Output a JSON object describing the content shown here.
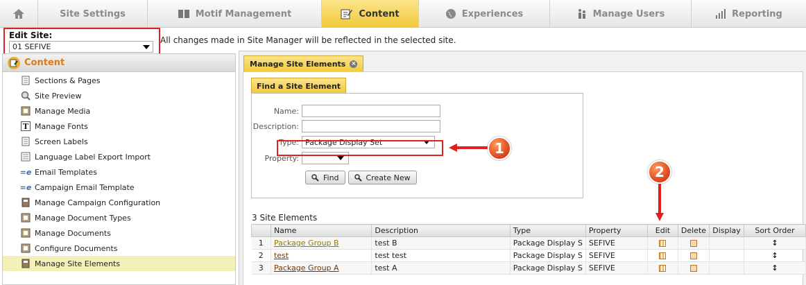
{
  "topnav": {
    "tabs": [
      {
        "label": "Site Settings",
        "icon": "settings-icon"
      },
      {
        "label": "Motif Management",
        "icon": "book-icon"
      },
      {
        "label": "Content",
        "icon": "edit-icon",
        "active": true
      },
      {
        "label": "Experiences",
        "icon": "globe-icon"
      },
      {
        "label": "Manage Users",
        "icon": "users-icon"
      },
      {
        "label": "Reporting",
        "icon": "bar-chart-icon"
      }
    ]
  },
  "edit_site": {
    "label": "Edit Site:",
    "value": "01 SEFIVE"
  },
  "notice": "All changes made in Site Manager will be reflected in the selected site.",
  "left_panel": {
    "title": "Content",
    "items": [
      {
        "label": "Sections & Pages",
        "icon": "document-icon"
      },
      {
        "label": "Site Preview",
        "icon": "magnifier-icon"
      },
      {
        "label": "Manage Media",
        "icon": "media-icon"
      },
      {
        "label": "Manage Fonts",
        "icon": "font-icon"
      },
      {
        "label": "Screen Labels",
        "icon": "document-icon"
      },
      {
        "label": "Language Label Export Import",
        "icon": "export-icon"
      },
      {
        "label": "Email Templates",
        "icon": "email-icon"
      },
      {
        "label": "Campaign Email Template",
        "icon": "email-icon"
      },
      {
        "label": "Manage Campaign Configuration",
        "icon": "config-icon"
      },
      {
        "label": "Manage Document Types",
        "icon": "media-icon"
      },
      {
        "label": "Manage Documents",
        "icon": "media-icon"
      },
      {
        "label": "Configure Documents",
        "icon": "media-icon"
      },
      {
        "label": "Manage Site Elements",
        "icon": "config-icon",
        "selected": true
      }
    ]
  },
  "main": {
    "tab_label": "Manage Site Elements",
    "find_title": "Find a Site Element",
    "fields": {
      "name_label": "Name:",
      "description_label": "Description:",
      "type_label": "Type:",
      "type_value": "Package Display Set",
      "property_label": "Property:"
    },
    "buttons": {
      "find": "Find",
      "create_new": "Create New"
    },
    "count_text": "3 Site Elements",
    "columns": [
      "",
      "Name",
      "Description",
      "Type",
      "Property",
      "Edit",
      "Delete",
      "Display",
      "Sort Order"
    ],
    "rows": [
      {
        "num": "1",
        "name": "Package Group B",
        "description": "test B",
        "type": "Package Display S",
        "property": "SEFIVE"
      },
      {
        "num": "2",
        "name": "test",
        "description": "test test",
        "type": "Package Display S",
        "property": "SEFIVE"
      },
      {
        "num": "3",
        "name": "Package Group A",
        "description": "test A",
        "type": "Package Display S",
        "property": "SEFIVE"
      }
    ]
  },
  "callouts": {
    "first": "1",
    "second": "2"
  },
  "colors": {
    "accent": "#f1c93a",
    "annotation_red": "#e02020",
    "left_title": "#e07a10"
  }
}
